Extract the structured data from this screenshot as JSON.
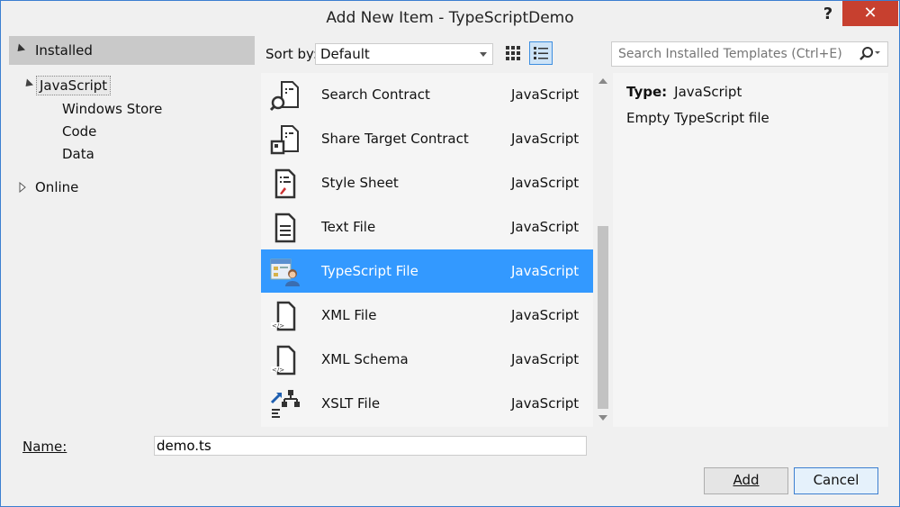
{
  "window": {
    "title": "Add New Item - TypeScriptDemo",
    "help_label": "?",
    "close_label": "✕"
  },
  "sidebar": {
    "installed_label": "Installed",
    "tree": [
      {
        "label": "JavaScript",
        "expanded": true,
        "selected": true
      },
      {
        "label": "Windows Store"
      },
      {
        "label": "Code"
      },
      {
        "label": "Data"
      },
      {
        "label": "Online",
        "expanded": false
      }
    ]
  },
  "toolbar": {
    "sort_label": "Sort by:",
    "sort_value": "Default"
  },
  "search": {
    "placeholder": "Search Installed Templates (Ctrl+E)"
  },
  "templates": [
    {
      "name": "Search Contract",
      "lang": "JavaScript",
      "icon": "search-contract-icon"
    },
    {
      "name": "Share Target Contract",
      "lang": "JavaScript",
      "icon": "share-target-icon"
    },
    {
      "name": "Style Sheet",
      "lang": "JavaScript",
      "icon": "stylesheet-icon"
    },
    {
      "name": "Text File",
      "lang": "JavaScript",
      "icon": "text-file-icon"
    },
    {
      "name": "TypeScript File",
      "lang": "JavaScript",
      "icon": "typescript-file-icon",
      "selected": true
    },
    {
      "name": "XML File",
      "lang": "JavaScript",
      "icon": "xml-file-icon"
    },
    {
      "name": "XML Schema",
      "lang": "JavaScript",
      "icon": "xml-schema-icon"
    },
    {
      "name": "XSLT File",
      "lang": "JavaScript",
      "icon": "xslt-file-icon"
    }
  ],
  "details": {
    "type_label": "Type:",
    "type_value": "JavaScript",
    "description": "Empty TypeScript file"
  },
  "name_field": {
    "label": "Name:",
    "value": "demo.ts"
  },
  "buttons": {
    "add": "Add",
    "cancel": "Cancel"
  },
  "colors": {
    "selection": "#3399ff",
    "close_button": "#c7402f",
    "accent_border": "#3c7fd0"
  }
}
